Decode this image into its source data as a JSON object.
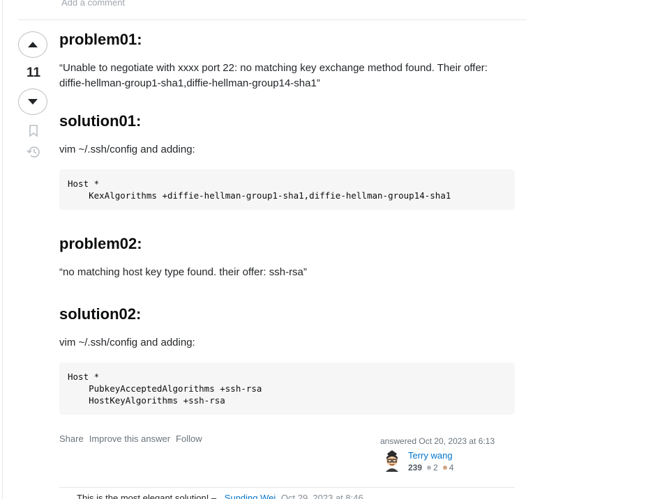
{
  "top": {
    "add_comment": "Add a comment"
  },
  "vote": {
    "count": "11"
  },
  "post": {
    "problem01_title": "problem01:",
    "problem01_text": "“Unable to negotiate with xxxx port 22: no matching key exchange method found. Their offer: diffie-hellman-group1-sha1,diffie-hellman-group14-sha1”",
    "solution01_title": "solution01:",
    "solution01_text": "vim ~/.ssh/config and adding:",
    "code1_line1": "Host *",
    "code1_line2": "    KexAlgorithms +diffie-hellman-group1-sha1,diffie-hellman-group14-sha1",
    "problem02_title": "problem02:",
    "problem02_text": "“no matching host key type found. their offer: ssh-rsa”",
    "solution02_title": "solution02:",
    "solution02_text": "vim ~/.ssh/config and adding:",
    "code2_line1": "Host *",
    "code2_line2": "    PubkeyAcceptedAlgorithms +ssh-rsa",
    "code2_line3": "    HostKeyAlgorithms +ssh-rsa"
  },
  "actions": {
    "share": "Share",
    "improve": "Improve this answer",
    "follow": "Follow"
  },
  "user": {
    "answered_label": "answered",
    "answered_date": "Oct 20, 2023 at 6:13",
    "name": "Terry wang",
    "reputation": "239",
    "silver": "2",
    "bronze": "4"
  },
  "comment": {
    "text": "This is the most elegant solution! –",
    "author": "Sunding Wei",
    "time": "Oct 29, 2023 at 8:46"
  },
  "colors": {
    "link": "#0074cc",
    "silver": "#b4b8bc",
    "bronze": "#d1a684"
  }
}
